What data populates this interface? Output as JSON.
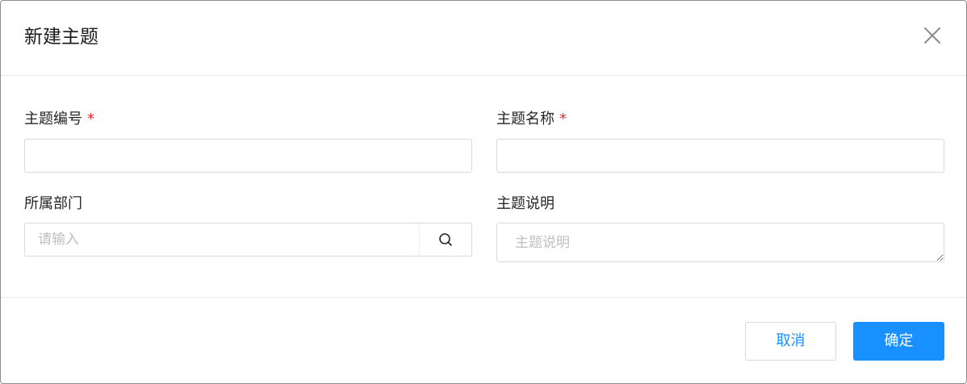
{
  "dialog": {
    "title": "新建主题",
    "close_icon": "close-icon"
  },
  "form": {
    "topic_code": {
      "label": "主题编号",
      "required_mark": "*",
      "value": "",
      "placeholder": ""
    },
    "topic_name": {
      "label": "主题名称",
      "required_mark": "*",
      "value": "",
      "placeholder": ""
    },
    "department": {
      "label": "所属部门",
      "value": "",
      "placeholder": "请输入",
      "icon": "search-icon"
    },
    "description": {
      "label": "主题说明",
      "value": "",
      "placeholder": "主题说明"
    }
  },
  "footer": {
    "cancel_label": "取消",
    "confirm_label": "确定"
  },
  "colors": {
    "primary": "#1890ff",
    "required": "#f5222d",
    "border": "#d9d9d9",
    "placeholder": "#bfbfbf"
  }
}
